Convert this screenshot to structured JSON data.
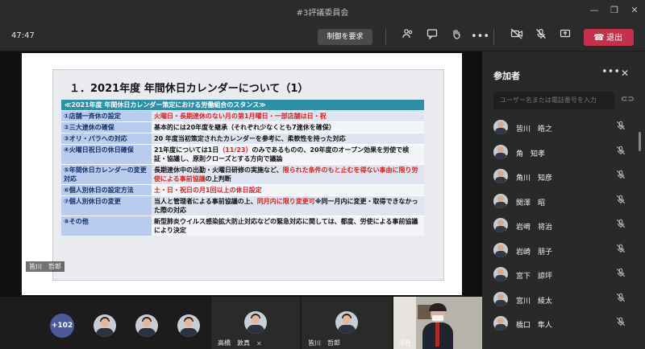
{
  "window": {
    "title": "#3評議委員会"
  },
  "toolbar": {
    "timer": "47:47",
    "request_control": "制御を要求",
    "leave_label": "退出",
    "icons": [
      "people-icon",
      "chat-icon",
      "raise-hand-icon",
      "more-icon",
      "camera-off-icon",
      "mic-off-icon",
      "share-icon",
      "phone-icon"
    ]
  },
  "slide": {
    "title": "１．2021年度 年間休日カレンダーについて（1）",
    "table_header": "≪2021年度 年間休日カレンダー策定における労働組合のスタンス≫",
    "rows": [
      {
        "key": "①店舗一斉休の設定",
        "value": "",
        "value_red": "火曜日・長期連休のない月の第1月曜日・一部店舗は日・祝",
        "value_after": ""
      },
      {
        "key": "②三大連休の確保",
        "value": "基本的には20年度を継承（それぞれ少なくとも7連休を確保）",
        "value_red": "",
        "value_after": ""
      },
      {
        "key": "③オリ・パラへの対応",
        "value": "20 年度当初策定されたカレンダーを参考に、柔軟性を持った対応",
        "value_red": "",
        "value_after": ""
      },
      {
        "key": "④火曜日祝日の休日確保",
        "value": "21年度については1日",
        "value_red": "（11/23）",
        "value_after": "のみであるものの、20年度のオープン効果を労使で検証・協議し、原則クローズとする方向で議論"
      },
      {
        "key": "⑤年間休日カレンダーの変更対応",
        "value": "長期連休中の出勤・火曜日研修の実施など、",
        "value_red": "限られた条件のもと止むを得ない事由に限り労使による事前協議",
        "value_after": "の上判断"
      },
      {
        "key": "⑥個人別休日の設定方法",
        "value": "",
        "value_red": "土・日・祝日の月1回以上の休日設定",
        "value_after": ""
      },
      {
        "key": "⑦個人別休日の変更",
        "value": "当人と管理者による事前協議の上、",
        "value_red": "同月内に限り変更可",
        "value_after": "※同一月内に変更・取得できなかった際の対応"
      },
      {
        "key": "⑧その他",
        "value": "新型肺炎ウイルス感染拡大防止対応などの緊急対応に関しては、都度、労使による事前協議により決定",
        "value_red": "",
        "value_after": ""
      }
    ]
  },
  "presenter": {
    "name": "皆川　哲郎"
  },
  "gallery": {
    "more_count": "+102",
    "tiles": [
      {
        "name": "高橋　敦真"
      },
      {
        "name": "皆川　哲郎"
      },
      {
        "name": "河合"
      }
    ]
  },
  "participants_panel": {
    "title": "参加者",
    "search_placeholder": "ユーザー名または電話番号を入力",
    "participants": [
      {
        "name": "皆川　皓之"
      },
      {
        "name": "角　知孝"
      },
      {
        "name": "角川　知彦"
      },
      {
        "name": "関澤　昭"
      },
      {
        "name": "岩﨑　将治"
      },
      {
        "name": "岩崎　朋子"
      },
      {
        "name": "宮下　諒坪"
      },
      {
        "name": "宮川　綾太"
      },
      {
        "name": "橋口　隼人"
      }
    ]
  }
}
